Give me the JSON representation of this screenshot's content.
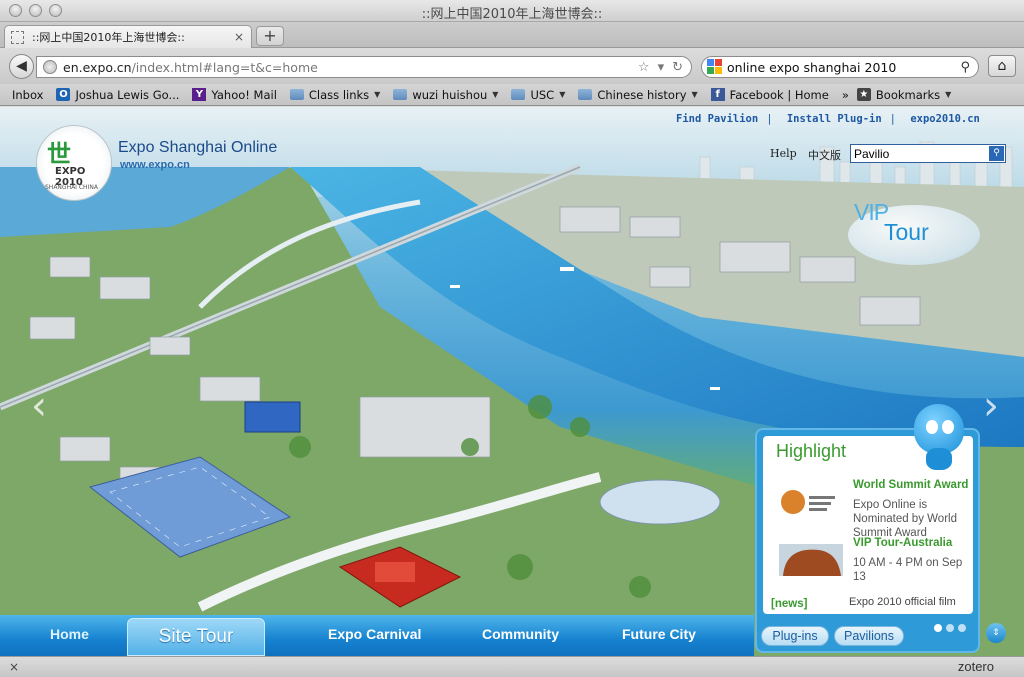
{
  "window": {
    "title": "::网上中国2010年上海世博会::"
  },
  "tab": {
    "label": "::网上中国2010年上海世博会::",
    "close": "×",
    "new_tab": "+"
  },
  "nav": {
    "back": "◀",
    "url_host": "en.expo.cn",
    "url_path": "/index.html#lang=t&c=home",
    "search_value": "online expo shanghai 2010",
    "home": "⌂"
  },
  "bookmarks": [
    {
      "label": "Inbox",
      "icon": "page-icon",
      "kind": "page",
      "glyph": "",
      "dropdown": false
    },
    {
      "label": "Joshua Lewis Go...",
      "icon": "outlook-icon",
      "kind": "outlook",
      "glyph": "O",
      "dropdown": false
    },
    {
      "label": "Yahoo! Mail",
      "icon": "yahoo-icon",
      "kind": "yahoo",
      "glyph": "Y",
      "dropdown": false
    },
    {
      "label": "Class links",
      "icon": "folder-icon",
      "kind": "folder",
      "glyph": "",
      "dropdown": true
    },
    {
      "label": "wuzi huishou",
      "icon": "folder-icon",
      "kind": "folder",
      "glyph": "",
      "dropdown": true
    },
    {
      "label": "USC",
      "icon": "folder-icon",
      "kind": "folder",
      "glyph": "",
      "dropdown": true
    },
    {
      "label": "Chinese history",
      "icon": "folder-icon",
      "kind": "folder",
      "glyph": "",
      "dropdown": true
    },
    {
      "label": "Facebook | Home",
      "icon": "facebook-icon",
      "kind": "fb",
      "glyph": "f",
      "dropdown": false
    }
  ],
  "bookmarks_overflow": "»",
  "bookmarks_menu": "Bookmarks",
  "site": {
    "logo_text": "EXPO",
    "logo_year": "2010",
    "logo_sub": "SHANGHAI CHINA",
    "title": "Expo Shanghai Online",
    "url": "www.expo.cn",
    "top_links": [
      "Find Pavilion",
      "Install Plug-in",
      "expo2010.cn"
    ],
    "help": "Help",
    "lang": "中文版",
    "search_value": "Pavilio",
    "vip_1": "VIP",
    "vip_2": "Tour"
  },
  "highlight": {
    "title": "Highlight",
    "items": [
      {
        "title": "World Summit Award",
        "desc": "Expo Online is Nominated by World Summit Award"
      },
      {
        "title": "VIP Tour-Australia",
        "desc": "10 AM - 4 PM on Sep 13"
      }
    ],
    "news": "[news]",
    "film": "Expo 2010 official film",
    "buttons": [
      "Plug-ins",
      "Pavilions"
    ]
  },
  "bottom_nav": [
    "Home",
    "Site Tour",
    "Expo Carnival",
    "Community",
    "Future City"
  ],
  "status": {
    "close": "×",
    "zotero": "zotero"
  },
  "colors": {
    "accent": "#1682d0",
    "highlight_green": "#3a9a2e",
    "link_blue": "#1c58a3"
  }
}
